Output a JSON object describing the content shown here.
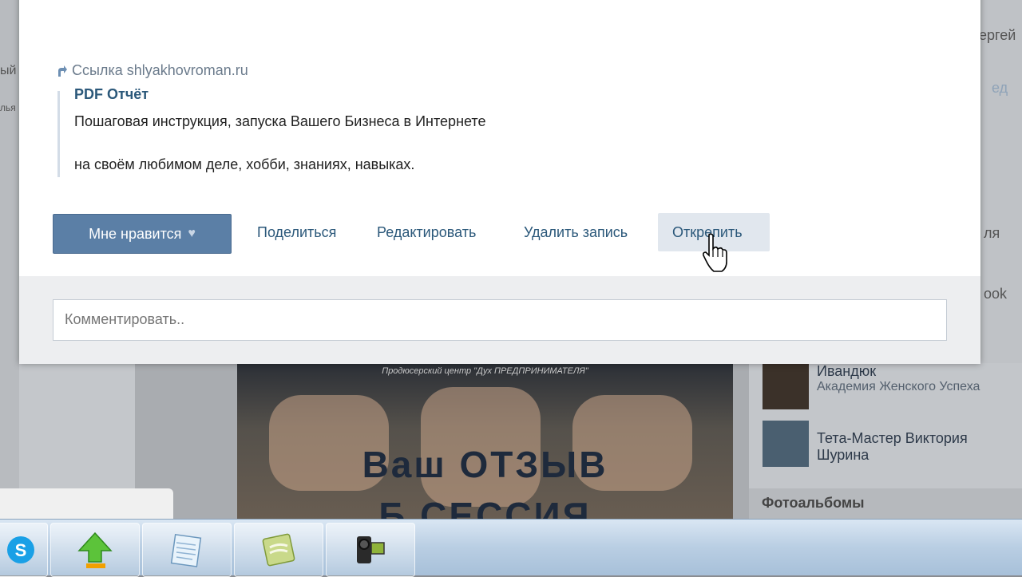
{
  "post": {
    "link_label": "Ссылка shlyakhovroman.ru",
    "attachment_title": "PDF Отчёт",
    "attachment_line1": "Пошаговая инструкция, запуска Вашего Бизнеса в Интернете",
    "attachment_line2": "на своём любимом деле, хобби, знаниях, навыках.",
    "actions": {
      "like": "Мне нравится",
      "share": "Поделиться",
      "edit": "Редактировать",
      "delete": "Удалить запись",
      "unpin": "Открепить"
    },
    "comment_placeholder": "Комментировать.."
  },
  "background": {
    "edge_texts": [
      "ергей",
      "ед",
      "ля",
      "ook",
      "ый",
      "лья"
    ],
    "banner_caption": "Продюсерский центр \"Дух ПРЕДПРИНИМАТЕЛЯ\"",
    "banner_line1": "Ваш ОТЗЫВ",
    "banner_line2": "Б СЕССИЯ",
    "sidebar_people": [
      {
        "name": "Ивандюк",
        "subtitle": "Академия Женского Успеха"
      },
      {
        "name": "Тета-Мастер Виктория",
        "subtitle": "Шурина"
      }
    ],
    "section_title": "Фотоальбомы"
  },
  "taskbar": {
    "apps": [
      "skype-icon",
      "upload-icon",
      "notepad-icon",
      "document-icon",
      "camera-icon"
    ]
  },
  "colors": {
    "link": "#2b587a",
    "like_button": "#5b7fa6",
    "unpin_hover": "#e1e7ee"
  }
}
